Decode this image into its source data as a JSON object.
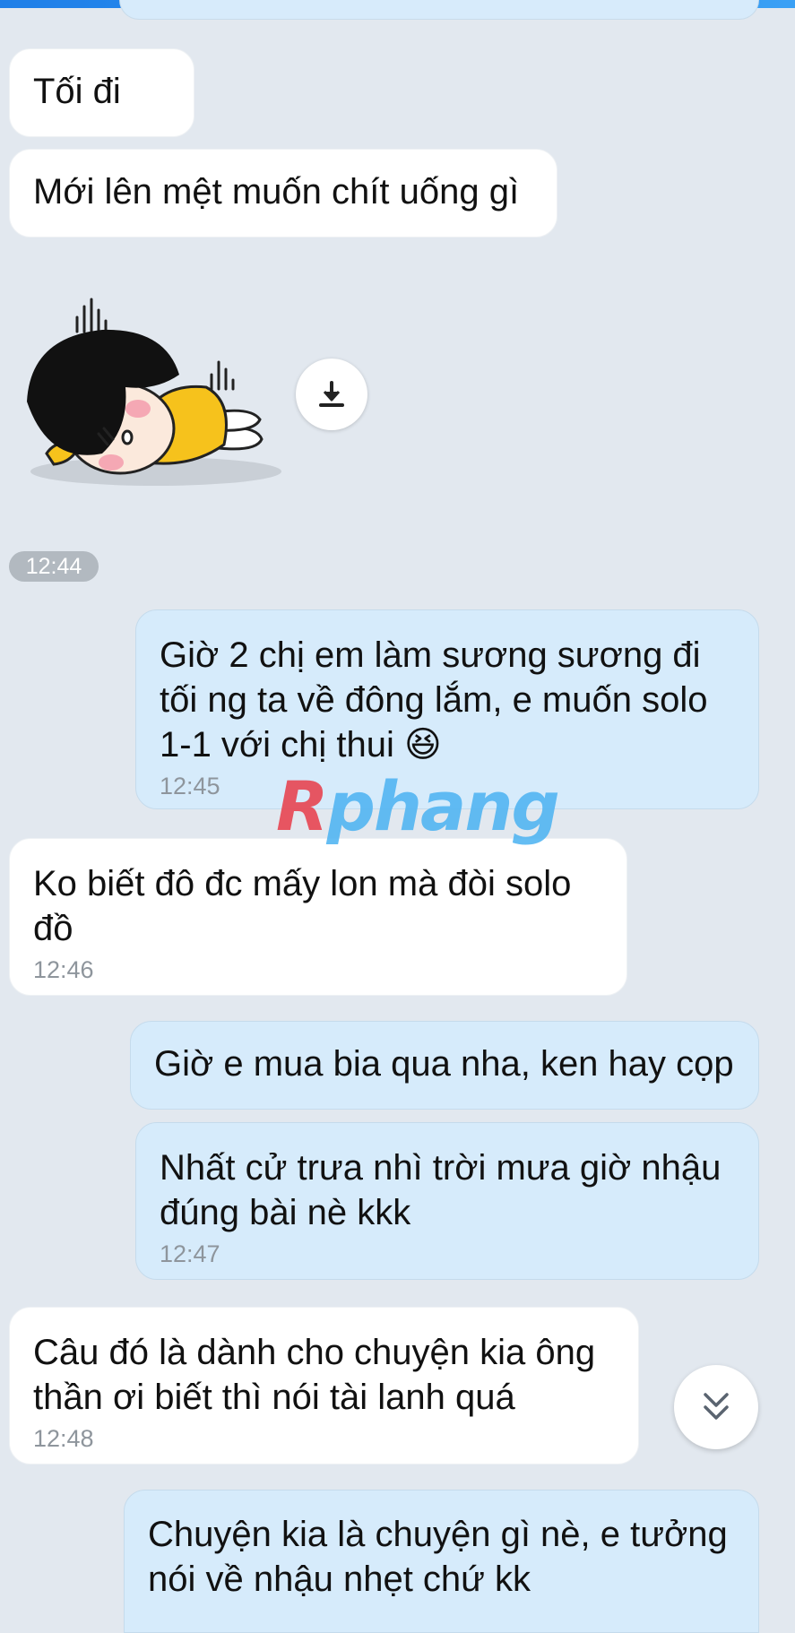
{
  "messages": [
    {
      "direction": "incoming",
      "text": "Tối đi"
    },
    {
      "direction": "incoming",
      "text": "Mới lên mệt muốn chít uống gì"
    },
    {
      "direction": "incoming",
      "type": "sticker",
      "sticker": "tired-kid-lying-down"
    },
    {
      "direction": "outgoing",
      "text": "Giờ 2 chị em làm sương sương đi\ntối ng ta về đông lắm, e muốn solo\n1-1 với chị thui",
      "emoji": "😆",
      "time": "12:45"
    },
    {
      "direction": "incoming",
      "text": "Ko biết đô đc mấy lon mà đòi solo\nđồ",
      "time": "12:46"
    },
    {
      "direction": "outgoing",
      "text": "Giờ e mua bia qua nha, ken hay cọp"
    },
    {
      "direction": "outgoing",
      "text": "Nhất cử trưa nhì trời mưa giờ nhậu\nđúng bài nè kkk",
      "time": "12:47"
    },
    {
      "direction": "incoming",
      "text": "Câu đó là dành cho chuyện kia ông\nthần ơi biết thì nói tài lanh quá",
      "time": "12:48"
    },
    {
      "direction": "outgoing",
      "text": "Chuyện kia là chuyện gì nè, e tưởng\nnói về nhậu nhẹt chứ kk"
    }
  ],
  "time_chip": "12:44",
  "watermark": {
    "first": "R",
    "rest": "phang"
  },
  "icons": {
    "download": "download-icon",
    "scroll_down": "chevrons-down-icon"
  },
  "colors": {
    "incoming_bubble": "#ffffff",
    "outgoing_bubble": "#d6ebfb",
    "background": "#e2e8ef",
    "top_bar": "#1f7fe8",
    "watermark_red": "#e8414e",
    "watermark_blue": "#4fb4f2"
  }
}
